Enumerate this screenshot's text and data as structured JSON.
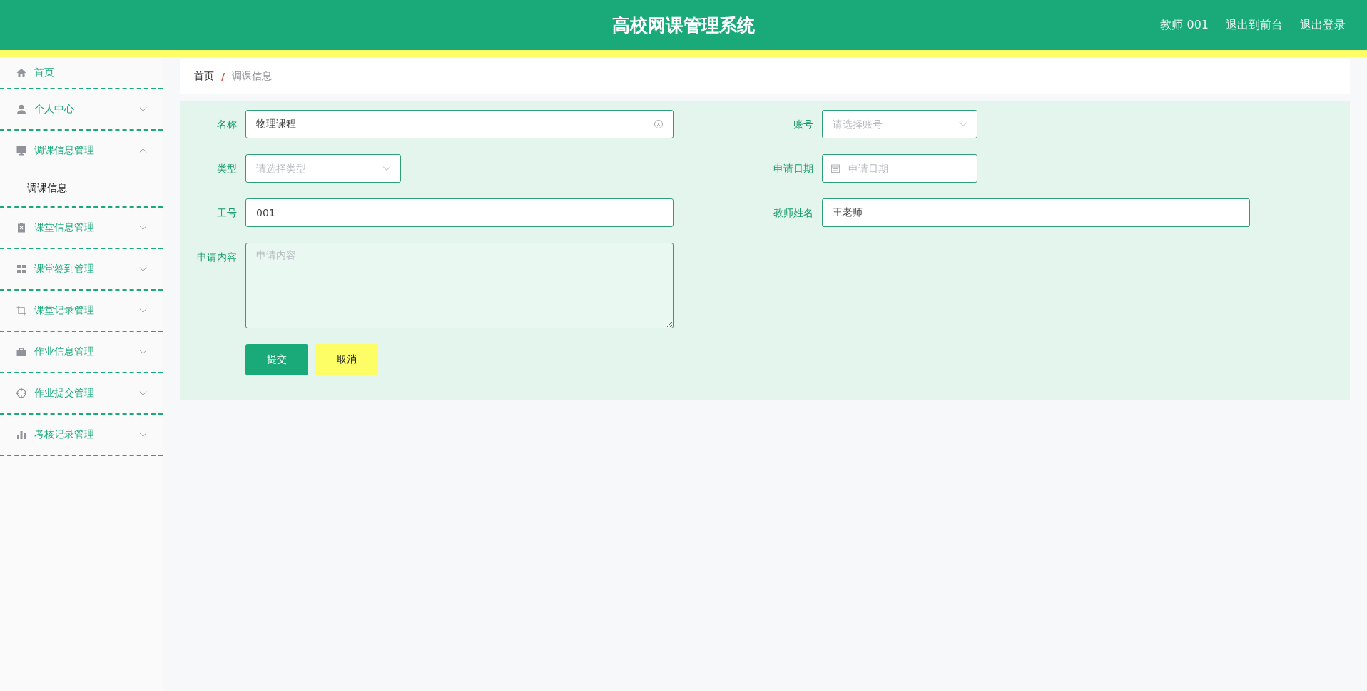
{
  "header": {
    "title": "高校网课管理系统",
    "user": "教师 001",
    "links": [
      "退出到前台",
      "退出登录"
    ]
  },
  "sidebar": {
    "items": [
      {
        "label": "首页"
      },
      {
        "label": "个人中心",
        "expanded": false
      },
      {
        "label": "调课信息管理",
        "expanded": true,
        "children": [
          {
            "label": "调课信息"
          }
        ]
      },
      {
        "label": "课堂信息管理",
        "expanded": false
      },
      {
        "label": "课堂签到管理",
        "expanded": false
      },
      {
        "label": "课堂记录管理",
        "expanded": false
      },
      {
        "label": "作业信息管理",
        "expanded": false
      },
      {
        "label": "作业提交管理",
        "expanded": false
      },
      {
        "label": "考核记录管理",
        "expanded": false
      }
    ]
  },
  "breadcrumb": {
    "items": [
      "首页",
      "调课信息"
    ],
    "separator": "/"
  },
  "form": {
    "rows": [
      [
        {
          "label": "名称",
          "kind": "text",
          "value": "物理课程",
          "clearable": true
        },
        {
          "label": "账号",
          "kind": "select",
          "placeholder": "请选择账号"
        }
      ],
      [
        {
          "label": "类型",
          "kind": "select",
          "placeholder": "请选择类型"
        },
        {
          "label": "申请日期",
          "kind": "date",
          "placeholder": "申请日期"
        }
      ],
      [
        {
          "label": "工号",
          "kind": "text",
          "value": "001"
        },
        {
          "label": "教师姓名",
          "kind": "text",
          "value": "王老师"
        }
      ],
      [
        {
          "label": "申请内容",
          "kind": "textarea",
          "placeholder": "申请内容"
        }
      ]
    ],
    "buttons": [
      {
        "label": "提交",
        "kind": "primary"
      },
      {
        "label": "取消",
        "kind": "secondary"
      }
    ]
  }
}
